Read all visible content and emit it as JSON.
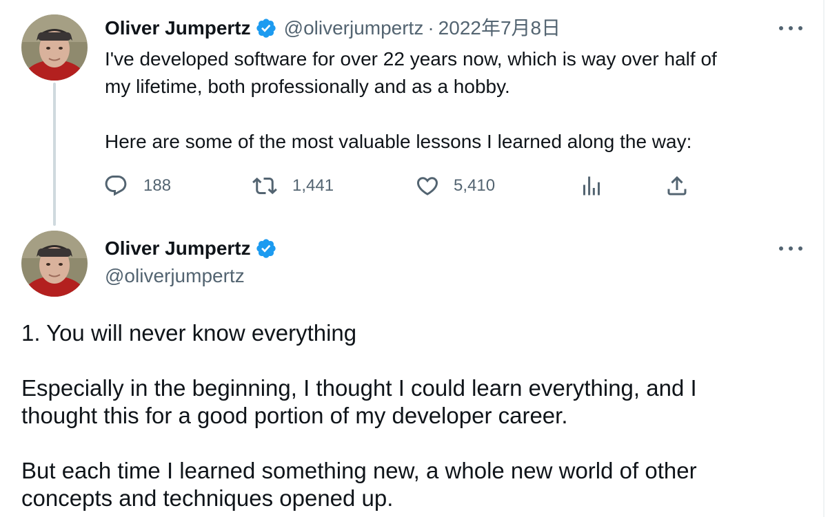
{
  "colors": {
    "text": "#0f1419",
    "secondary": "#536471",
    "verified_badge": "#1d9bf0",
    "thread_line": "#cfd9de"
  },
  "tweet1": {
    "author_name": "Oliver Jumpertz",
    "handle": "@oliverjumpertz",
    "separator": "·",
    "date": "2022年7月8日",
    "text_line1": "I've developed software for over 22 years now, which is way over half of",
    "text_line2": "my lifetime, both professionally and as a hobby.",
    "text_line3": "Here are some of the most valuable lessons I learned along the way:",
    "actions": {
      "reply_count": "188",
      "retweet_count": "1,441",
      "like_count": "5,410"
    },
    "icons": [
      "verified-badge-icon",
      "more-options-icon",
      "reply-icon",
      "retweet-icon",
      "like-icon",
      "analytics-icon",
      "share-icon"
    ]
  },
  "tweet2": {
    "author_name": "Oliver Jumpertz",
    "handle": "@oliverjumpertz",
    "line1": "1. You will never know everything",
    "line2": "Especially in the beginning, I thought I could learn everything, and I",
    "line3": "thought this for a good portion of my developer career.",
    "line4": "But each time I learned something new, a whole new world of other",
    "line5": "concepts and techniques opened up.",
    "icons": [
      "verified-badge-icon",
      "more-options-icon"
    ]
  }
}
